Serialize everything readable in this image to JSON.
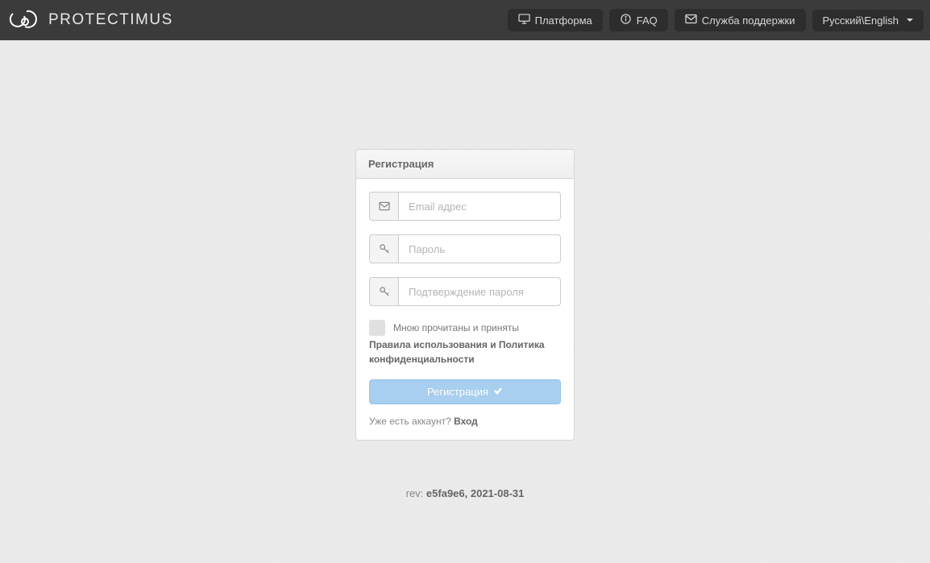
{
  "nav": {
    "brand": "protectimus",
    "platform": "Платформа",
    "faq": "FAQ",
    "support": "Служба поддержки",
    "lang": "Русский\\English"
  },
  "form": {
    "title": "Регистрация",
    "email_placeholder": "Email адрес",
    "password_placeholder": "Пароль",
    "confirm_placeholder": "Подтверждение пароля",
    "terms_intro": "Мною прочитаны и приняты",
    "terms_link": "Правила использования и Политика конфиденциальности",
    "submit": "Регистрация",
    "have_account": "Уже есть аккаунт? ",
    "login": "Вход"
  },
  "footer": {
    "rev_label": "rev: ",
    "rev_value": "e5fa9e6, 2021-08-31"
  }
}
